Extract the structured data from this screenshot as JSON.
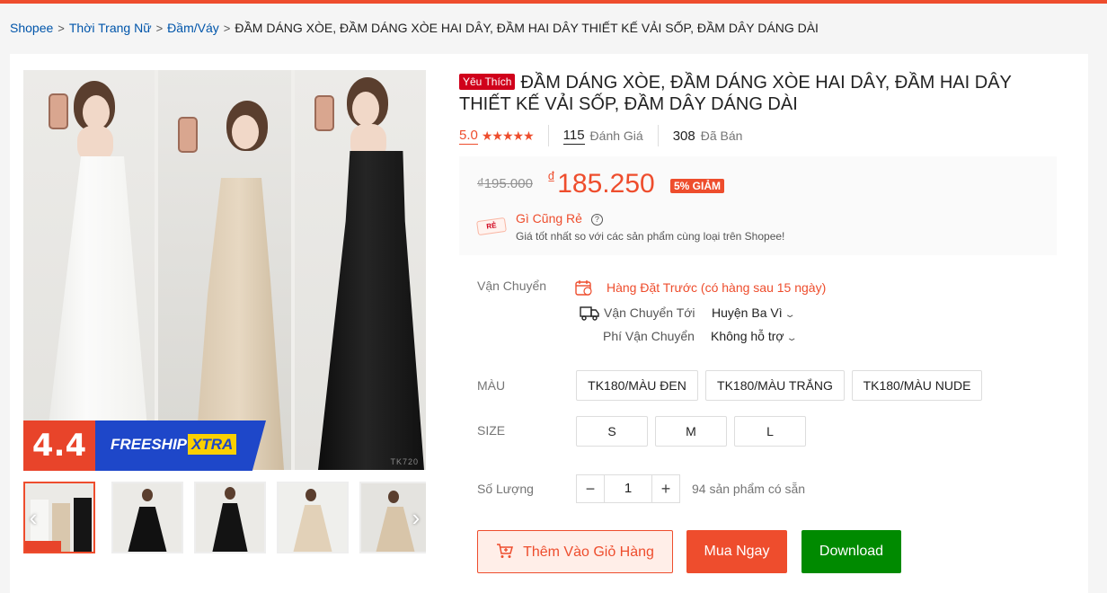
{
  "breadcrumb": {
    "items": [
      "Shopee",
      "Thời Trang Nữ",
      "Đầm/Váy"
    ],
    "current": "ĐẦM DÁNG XÒE, ĐẦM DÁNG XÒE HAI DÂY, ĐẦM HAI DÂY THIẾT KẾ VẢI SỐP, ĐẦM DÂY DÁNG DÀI"
  },
  "gallery": {
    "promo_number": "4.4",
    "promo_freeship": "FREESHIP",
    "promo_xtra": "XTRA",
    "watermark": "TK720"
  },
  "product": {
    "badge": "Yêu Thích",
    "title": "ĐẦM DÁNG XÒE, ĐẦM DÁNG XÒE HAI DÂY, ĐẦM HAI DÂY THIẾT KẾ VẢI SỐP, ĐẦM DÂY DÁNG DÀI",
    "rating": "5.0",
    "stars": "★★★★★",
    "reviews_count": "115",
    "reviews_label": "Đánh Giá",
    "sold_count": "308",
    "sold_label": "Đã Bán"
  },
  "price": {
    "original": "₫195.000",
    "currency": "₫",
    "current": "185.250",
    "discount": "5% GIẢM",
    "cheap_icon_text": "RẺ",
    "cheap_title": "Gì Cũng Rẻ",
    "cheap_desc": "Giá tốt nhất so với các sản phẩm cùng loại trên Shopee!"
  },
  "shipping": {
    "label": "Vận Chuyển",
    "preorder": "Hàng Đặt Trước (có hàng sau 15 ngày)",
    "to_label": "Vận Chuyển Tới",
    "to_value": "Huyện Ba Vì",
    "fee_label": "Phí Vận Chuyển",
    "fee_value": "Không hỗ trợ"
  },
  "color": {
    "label": "MÀU",
    "options": [
      "TK180/MÀU ĐEN",
      "TK180/MÀU TRẮNG",
      "TK180/MÀU NUDE"
    ]
  },
  "size": {
    "label": "SIZE",
    "options": [
      "S",
      "M",
      "L"
    ]
  },
  "quantity": {
    "label": "Số Lượng",
    "minus": "−",
    "value": "1",
    "plus": "+",
    "stock": "94 sản phẩm có sẵn"
  },
  "actions": {
    "add_to_cart": "Thêm Vào Giỏ Hàng",
    "buy_now": "Mua Ngay",
    "download": "Download"
  },
  "colors": {
    "accent": "#ee4d2d",
    "download": "#008a00",
    "link": "#0055aa"
  }
}
